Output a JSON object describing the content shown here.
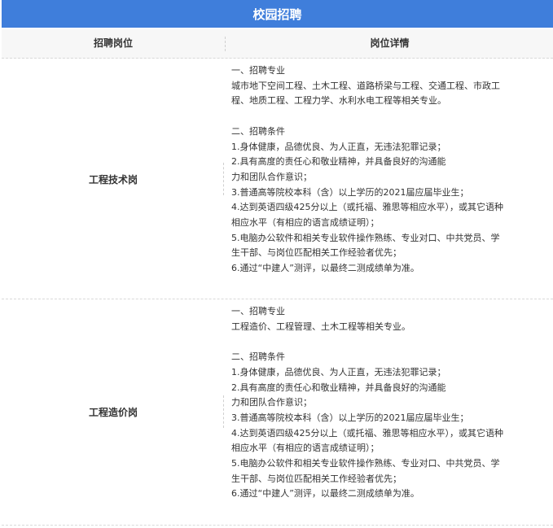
{
  "title": "校园招聘",
  "table": {
    "headers": [
      "招聘岗位",
      "岗位详情"
    ],
    "rows": [
      {
        "position": "工程技术岗",
        "major_heading": "一、招聘专业",
        "major_lines": [
          "城市地下空间工程、土木工程、道路桥梁与工程、交通工程、市政工",
          "程、地质工程、工程力学、水利水电工程等相关专业。"
        ],
        "cond_heading": "二、招聘条件",
        "cond_lines": [
          "1.身体健康，品德优良、为人正直，无违法犯罪记录；",
          "2.具有高度的责任心和敬业精神，并具备良好的沟通能",
          "力和团队合作意识；",
          "3.普通高等院校本科（含）以上学历的2021届应届毕业生；",
          "4.达到英语四级425分以上（或托福、雅思等相应水平），或其它语种",
          "相应水平（有相应的语言成绩证明）；",
          "5.电脑办公软件和相关专业软件操作熟练、专业对口、中共党员、学",
          "生干部、与岗位匹配相关工作经验者优先；",
          "6.通过“中建人”测评，以最终二测成绩单为准。"
        ]
      },
      {
        "position": "工程造价岗",
        "major_heading": "一、招聘专业",
        "major_lines": [
          "工程造价、工程管理、土木工程等相关专业。"
        ],
        "cond_heading": "二、招聘条件",
        "cond_lines": [
          "1.身体健康，品德优良、为人正直，无违法犯罪记录；",
          "2.具有高度的责任心和敬业精神，并具备良好的沟通能",
          "力和团队合作意识；",
          "3.普通高等院校本科（含）以上学历的2021届应届毕业生；",
          "4.达到英语四级425分以上（或托福、雅思等相应水平），或其它语种",
          "相应水平（有相应的语言成绩证明）；",
          "5.电脑办公软件和相关专业软件操作熟练、专业对口、中共党员、学",
          "生干部、与岗位匹配相关工作经验者优先；",
          "6.通过“中建人”测评，以最终二测成绩单为准。"
        ]
      }
    ]
  }
}
